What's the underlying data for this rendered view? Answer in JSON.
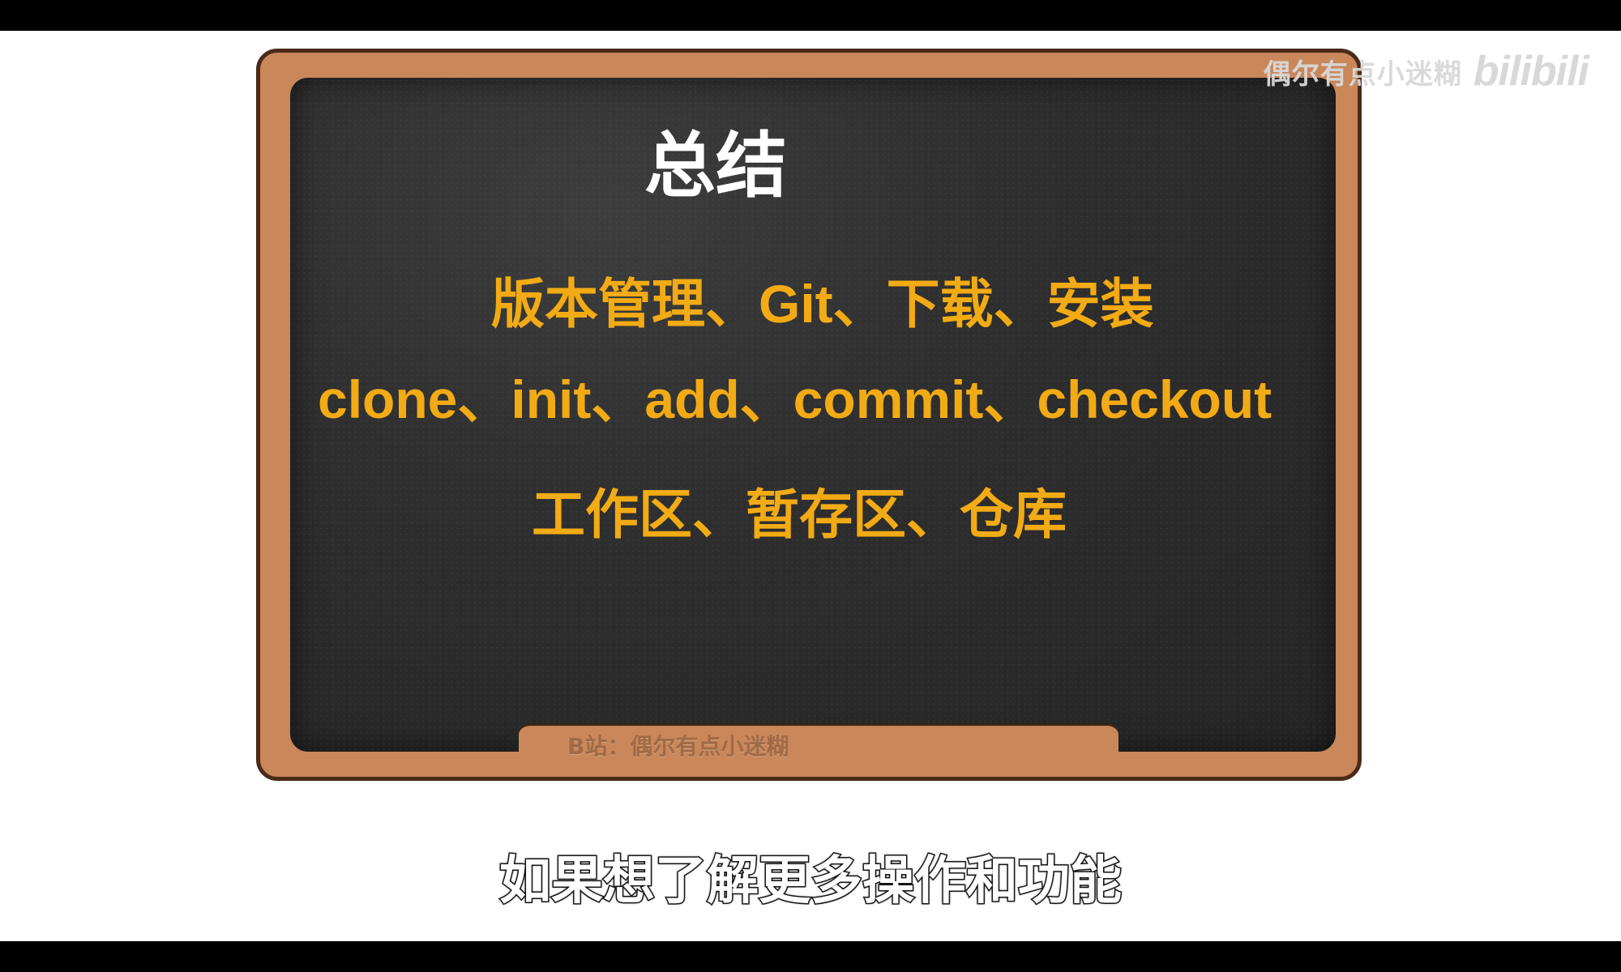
{
  "video": {
    "watermark_text": "偶尔有点小迷糊",
    "watermark_logo": "bilibili",
    "board_title": "总结",
    "topics": [
      "版本管理、Git、下载、安装",
      "clone、init、add、commit、checkout",
      "工作区、暂存区、仓库"
    ],
    "ledge_label": "B站：偶尔有点小迷糊",
    "subtitle": "如果想了解更多操作和功能"
  },
  "colors": {
    "board": "#2e2e2e",
    "frame": "#c9875a",
    "topic_text": "#f2ab14",
    "title_text": "#ffffff"
  }
}
